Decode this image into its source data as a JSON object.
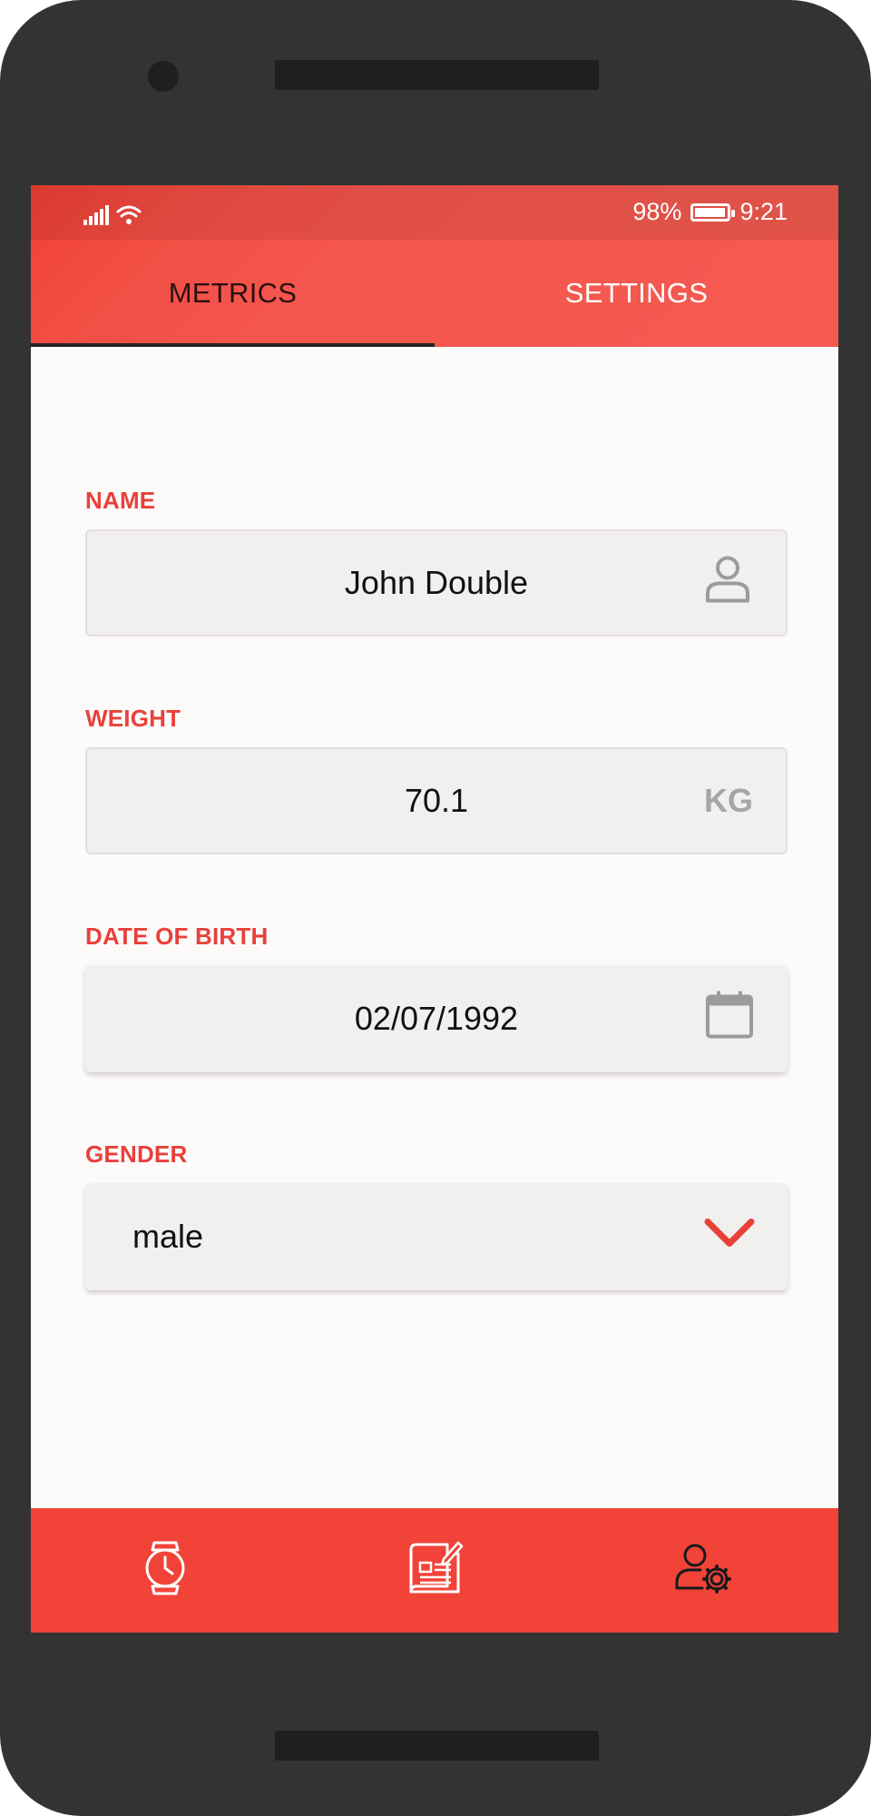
{
  "status_bar": {
    "battery_percent": "98%",
    "battery_level": 0.98,
    "time": "9:21",
    "signal_icon": "signal-icon",
    "wifi_icon": "wifi-icon",
    "battery_icon": "battery-icon"
  },
  "tabs": [
    {
      "label": "METRICS",
      "active": true
    },
    {
      "label": "SETTINGS",
      "active": false
    }
  ],
  "form": {
    "name": {
      "label": "NAME",
      "value": "John Double",
      "icon": "person-icon"
    },
    "weight": {
      "label": "WEIGHT",
      "value": "70.1",
      "unit": "KG"
    },
    "dob": {
      "label": "DATE OF BIRTH",
      "value": "02/07/1992",
      "icon": "calendar-icon"
    },
    "gender": {
      "label": "GENDER",
      "value": "male",
      "icon": "chevron-down-icon"
    }
  },
  "bottom_nav": [
    {
      "icon": "watch-icon"
    },
    {
      "icon": "blueprint-edit-icon"
    },
    {
      "icon": "user-settings-icon"
    }
  ],
  "colors": {
    "accent": "#f24338",
    "label": "#e8413a",
    "device": "#333333",
    "screen_bg": "#fdfafa"
  }
}
